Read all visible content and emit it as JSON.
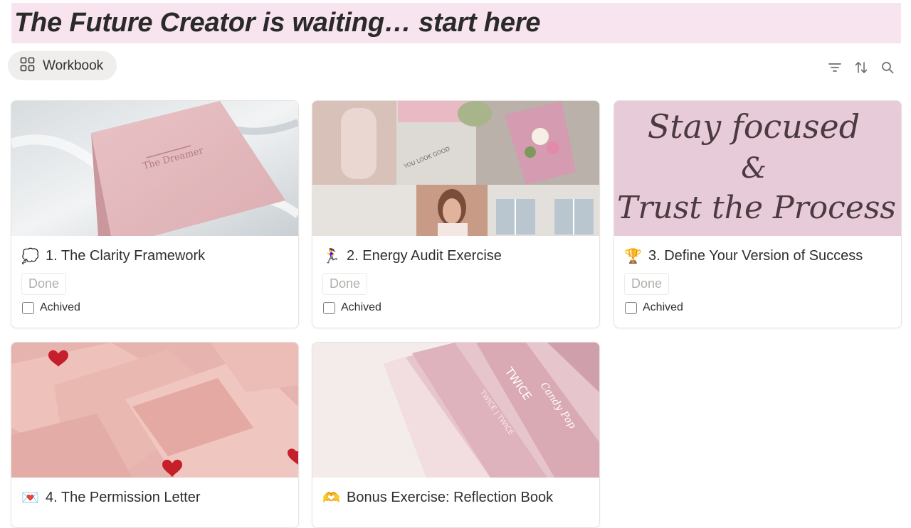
{
  "page": {
    "heading": "The Future Creator is waiting… start here"
  },
  "view": {
    "tab_label": "Workbook",
    "tab_icon": "gallery-grid-icon"
  },
  "toolbar": {
    "icons": [
      "filter-icon",
      "sort-icon",
      "search-icon"
    ]
  },
  "cards": [
    {
      "emoji": "💭",
      "title": "1. The Clarity Framework",
      "status": "Done",
      "checkbox_label": "Achived",
      "checked": false
    },
    {
      "emoji": "🏃‍♀️",
      "title": "2.  Energy Audit Exercise",
      "status": "Done",
      "checkbox_label": "Achived",
      "checked": false
    },
    {
      "emoji": "🏆",
      "title": "3. Define Your Version of Success",
      "status": "Done",
      "checkbox_label": "Achived",
      "checked": false,
      "cover_text": [
        "Stay focused",
        "&",
        "Trust the Process"
      ]
    },
    {
      "emoji": "💌",
      "title": "4. The Permission Letter"
    },
    {
      "emoji": "🫶",
      "title": "Bonus Exercise: Reflection Book"
    }
  ]
}
